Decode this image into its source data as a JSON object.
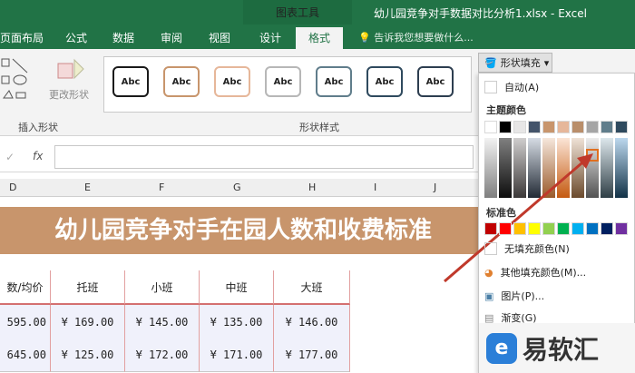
{
  "app": {
    "context_tab_group": "图表工具",
    "window_title": "幼儿园竞争对手数据对比分析1.xlsx - Excel"
  },
  "tabs": [
    "页面布局",
    "公式",
    "数据",
    "审阅",
    "视图",
    "设计",
    "格式"
  ],
  "active_tab": "格式",
  "tell_me": "告诉我您想要做什么...",
  "ribbon": {
    "insert_shapes_label": "插入形状",
    "edit_shape_label": "更改形状",
    "shape_styles_label": "形状样式",
    "style_sample_text": "Abc",
    "style_border_colors": [
      "#1a1a1a",
      "#c8956c",
      "#e6b79a",
      "#b7b7b7",
      "#607d8b",
      "#2f4a5e",
      "#2d3e50"
    ]
  },
  "formula_bar": {
    "fx": "fx",
    "cancel": "✓"
  },
  "columns": [
    "D",
    "E",
    "F",
    "G",
    "H",
    "I",
    "J"
  ],
  "sheet": {
    "banner_title": "幼儿园竞争对手在园人数和收费标准",
    "headers": [
      "数/均价",
      "托班",
      "小班",
      "中班",
      "大班"
    ],
    "rows": [
      [
        "595.00",
        "¥ 169.00",
        "¥ 145.00",
        "¥ 135.00",
        "¥ 146.00"
      ],
      [
        "645.00",
        "¥ 125.00",
        "¥ 172.00",
        "¥ 171.00",
        "¥ 177.00"
      ]
    ]
  },
  "dropdown": {
    "button_label": "形状填充",
    "automatic": "自动(A)",
    "theme_colors_label": "主题颜色",
    "standard_colors_label": "标准色",
    "no_fill": "无填充颜色(N)",
    "more_colors": "其他填充颜色(M)...",
    "picture": "图片(P)...",
    "gradient": "渐变(G)",
    "theme_top_row": [
      "#ffffff",
      "#000000",
      "#e7e6e6",
      "#44546a",
      "#c8956c",
      "#e6b79a",
      "#b98e6a",
      "#a5a5a5",
      "#607d8b",
      "#2f4a5e",
      "#4a7fa6"
    ],
    "standard_colors": [
      "#c00000",
      "#ff0000",
      "#ffc000",
      "#ffff00",
      "#92d050",
      "#00b050",
      "#00b0f0",
      "#0070c0",
      "#002060",
      "#7030a0"
    ]
  },
  "watermark": {
    "brand_text": "易软汇",
    "logo_glyph": "e"
  }
}
